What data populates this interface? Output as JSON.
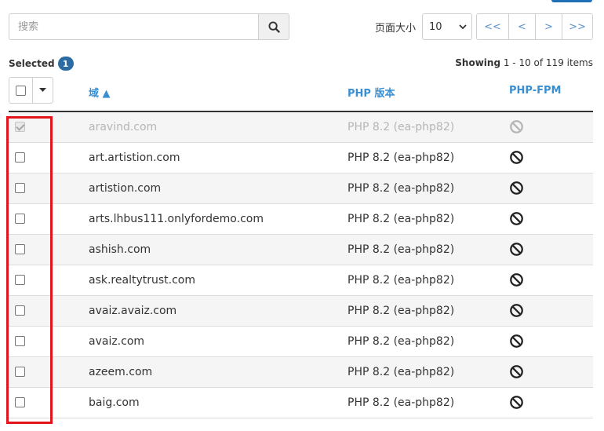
{
  "search": {
    "placeholder": "搜索"
  },
  "page_size": {
    "label": "页面大小",
    "value": "10"
  },
  "pager": {
    "first": "<<",
    "prev": "<",
    "next": ">",
    "last": ">>"
  },
  "selection": {
    "label": "Selected",
    "count": "1"
  },
  "showing": {
    "prefix": "Showing",
    "range": "1 - 10 of 119 items"
  },
  "columns": {
    "domain": "域 ▲",
    "php": "PHP 版本",
    "fpm": "PHP-FPM"
  },
  "rows": [
    {
      "domain": "aravind.com",
      "php": "PHP 8.2 (ea-php82)",
      "checked": true,
      "disabled": true
    },
    {
      "domain": "art.artistion.com",
      "php": "PHP 8.2 (ea-php82)"
    },
    {
      "domain": "artistion.com",
      "php": "PHP 8.2 (ea-php82)"
    },
    {
      "domain": "arts.lhbus111.onlyfordemo.com",
      "php": "PHP 8.2 (ea-php82)"
    },
    {
      "domain": "ashish.com",
      "php": "PHP 8.2 (ea-php82)"
    },
    {
      "domain": "ask.realtytrust.com",
      "php": "PHP 8.2 (ea-php82)"
    },
    {
      "domain": "avaiz.avaiz.com",
      "php": "PHP 8.2 (ea-php82)"
    },
    {
      "domain": "avaiz.com",
      "php": "PHP 8.2 (ea-php82)"
    },
    {
      "domain": "azeem.com",
      "php": "PHP 8.2 (ea-php82)"
    },
    {
      "domain": "baig.com",
      "php": "PHP 8.2 (ea-php82)"
    }
  ],
  "icons": {
    "search": "search-icon",
    "fpm_status": "ban-icon",
    "caret": "caret-down-icon"
  },
  "colors": {
    "accent": "#3a8fd1",
    "badge": "#2d6ca2",
    "highlight": "#e3141c",
    "disabled_text": "#b5b5b5"
  }
}
